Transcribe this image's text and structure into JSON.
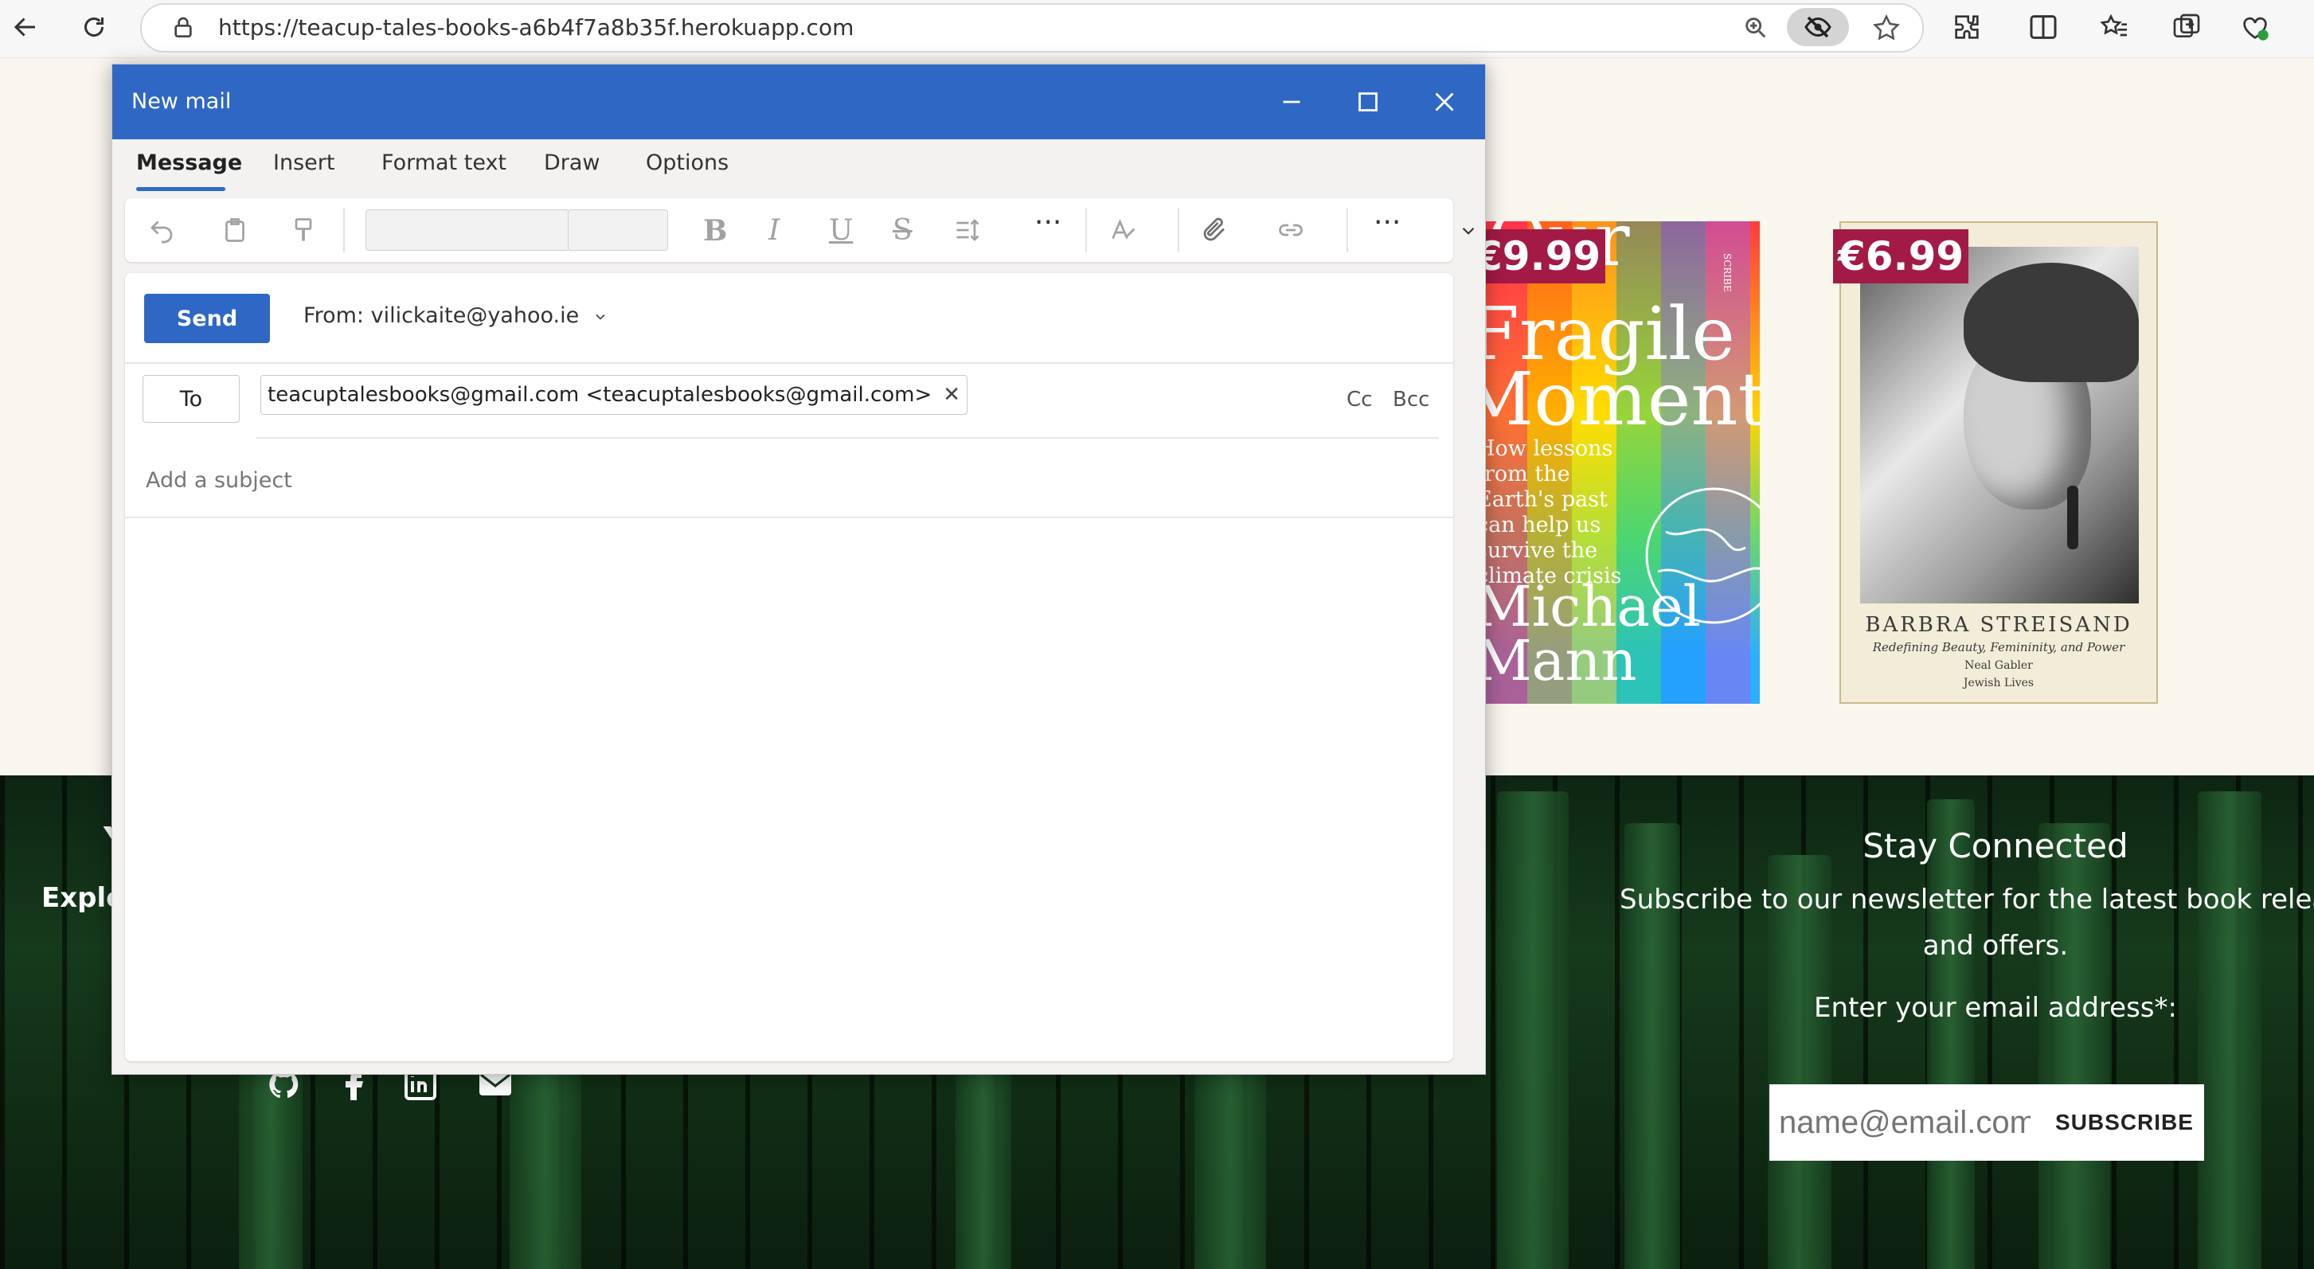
{
  "browser": {
    "url": "https://teacup-tales-books-a6b4f7a8b35f.herokuapp.com"
  },
  "books": [
    {
      "price": "€9.99",
      "title_lines": [
        "Our",
        "Fragile",
        "Moment"
      ],
      "subtitle": "How lessons from the Earth's past can help us survive the climate crisis",
      "author": "Michael Mann",
      "publisher": "SCRIBE"
    },
    {
      "price": "€6.99",
      "title": "BARBRA STREISAND",
      "subtitle": "Redefining Beauty, Femininity, and Power",
      "author": "Neal Gabler",
      "series": "Jewish Lives"
    }
  ],
  "footer": {
    "left_heading_fragment": "Y",
    "left_text_fragment": "Explo",
    "stay_connected": "Stay Connected",
    "newsletter_line1": "Subscribe to our newsletter for the latest book releases, ev",
    "newsletter_line2": "and offers.",
    "email_label": "Enter your email address*:",
    "email_placeholder": "name@email.com",
    "subscribe_label": "SUBSCRIBE",
    "social_icons": [
      "github-icon",
      "facebook-icon",
      "linkedin-icon",
      "mail-icon"
    ]
  },
  "mail": {
    "title": "New mail",
    "tabs": [
      "Message",
      "Insert",
      "Format text",
      "Draw",
      "Options"
    ],
    "send_label": "Send",
    "from_label": "From:",
    "from_value": "vilickaite@yahoo.ie",
    "to_label": "To",
    "recipient": "teacuptalesbooks@gmail.com <teacuptalesbooks@gmail.com>",
    "cc_label": "Cc",
    "bcc_label": "Bcc",
    "subject_placeholder": "Add a subject",
    "accent": "#2f68c4"
  }
}
